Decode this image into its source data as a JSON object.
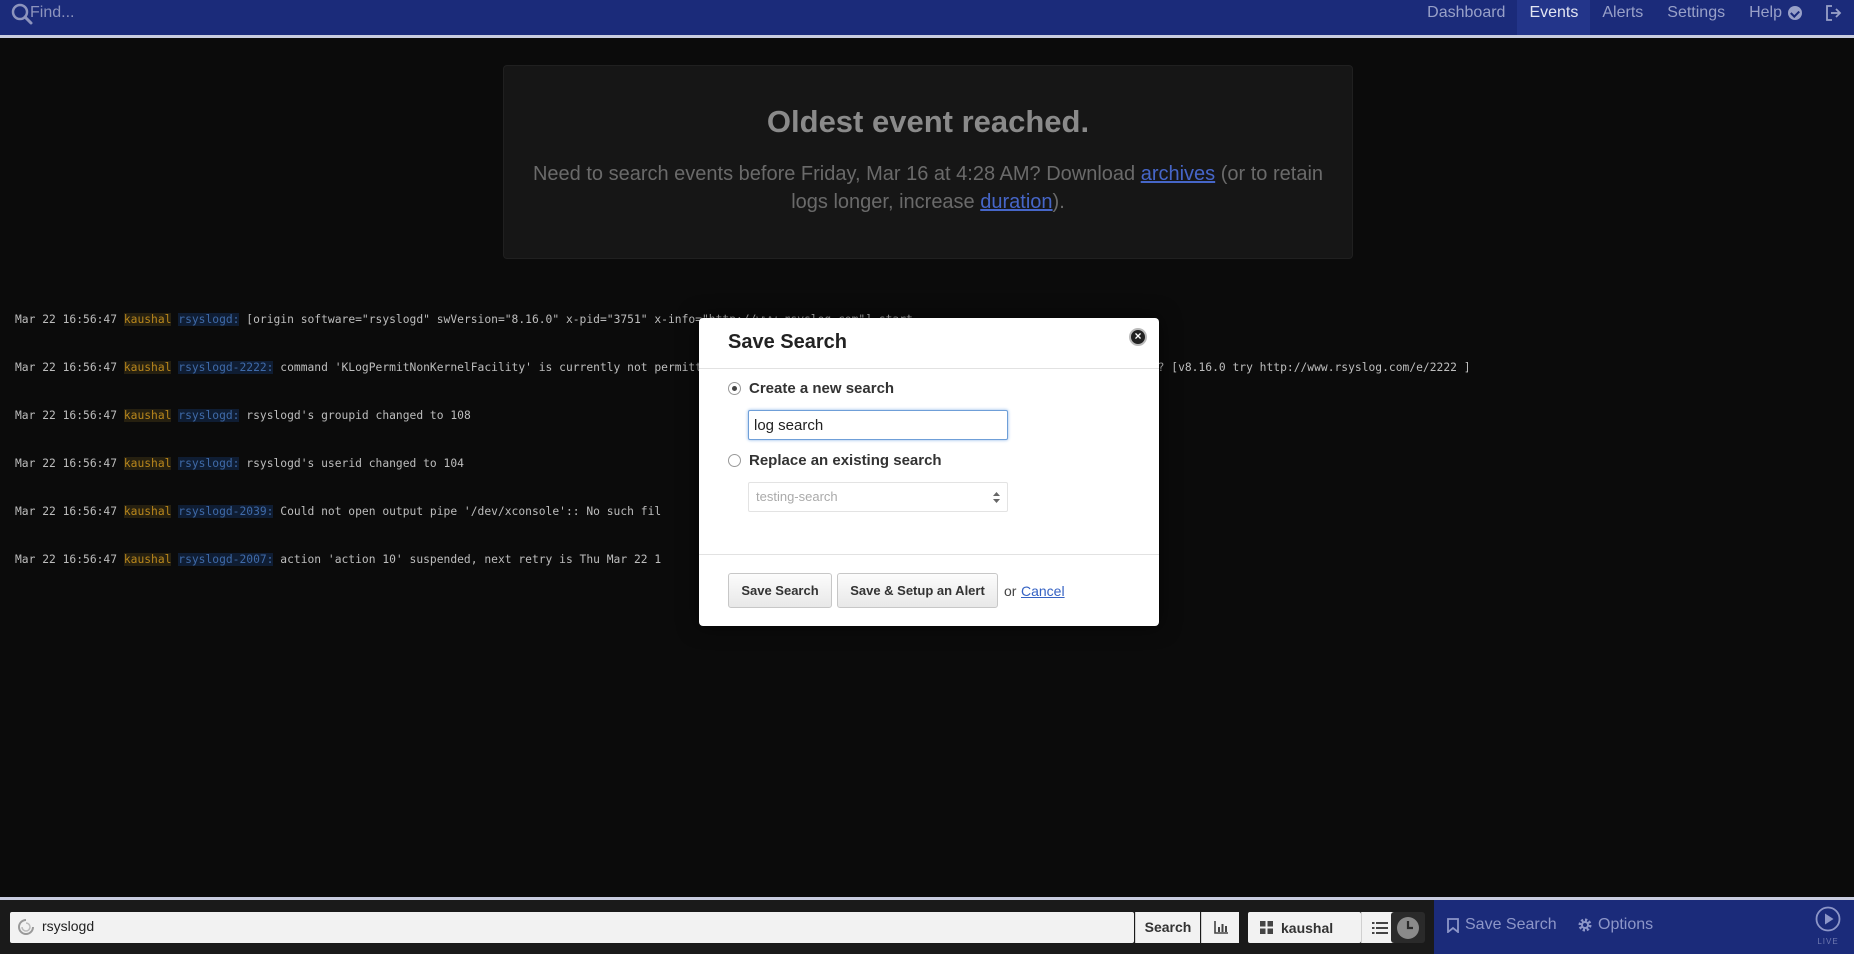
{
  "topbar": {
    "find_placeholder": "Find...",
    "nav": [
      "Dashboard",
      "Events",
      "Alerts",
      "Settings",
      "Help"
    ],
    "active_nav": "Events"
  },
  "oldest": {
    "title": "Oldest event reached.",
    "text_1": "Need to search events before Friday, Mar 16 at 4:28 AM? Download ",
    "archives_link": "archives",
    "text_2": " (or to retain logs longer, increase ",
    "duration_link": "duration",
    "text_3": ")."
  },
  "logs": [
    {
      "time": "Mar 22 16:56:47",
      "host": "kaushal",
      "program": "rsyslogd:",
      "message": "[origin software=\"rsyslogd\" swVersion=\"8.16.0\" x-pid=\"3751\" x-info=\"http://www.rsyslog.com\"] start"
    },
    {
      "time": "Mar 22 16:56:47",
      "host": "kaushal",
      "program": "rsyslogd-2222:",
      "message": "command 'KLogPermitNonKernelFacility' is currently not permitted - did you already set it via a RainerScript command (v6+ config)? [v8.16.0 try http://www.rsyslog.com/e/2222 ]"
    },
    {
      "time": "Mar 22 16:56:47",
      "host": "kaushal",
      "program": "rsyslogd:",
      "message": "rsyslogd's groupid changed to 108"
    },
    {
      "time": "Mar 22 16:56:47",
      "host": "kaushal",
      "program": "rsyslogd:",
      "message": "rsyslogd's userid changed to 104"
    },
    {
      "time": "Mar 22 16:56:47",
      "host": "kaushal",
      "program": "rsyslogd-2039:",
      "message": "Could not open output pipe '/dev/xconsole':: No such fil"
    },
    {
      "time": "Mar 22 16:56:47",
      "host": "kaushal",
      "program": "rsyslogd-2007:",
      "message": "action 'action 10' suspended, next retry is Thu Mar 22 1"
    }
  ],
  "modal": {
    "title": "Save Search",
    "close_icon": "×",
    "option_new": "Create a new search",
    "new_value": "log search",
    "option_replace": "Replace an existing search",
    "replace_selected": "testing-search",
    "save_button": "Save Search",
    "save_alert_button": "Save & Setup an Alert",
    "or_text": "or",
    "cancel_link": "Cancel"
  },
  "bottombar": {
    "query": "rsyslogd",
    "search_button": "Search",
    "group_label": "kaushal",
    "save_search": "Save Search",
    "options": "Options",
    "live_label": "LIVE"
  },
  "colors": {
    "topbar_bg": "#1b2b7a",
    "host_highlight": "#b8861c",
    "program_highlight": "#3f6aa8",
    "link": "#3562c3"
  }
}
